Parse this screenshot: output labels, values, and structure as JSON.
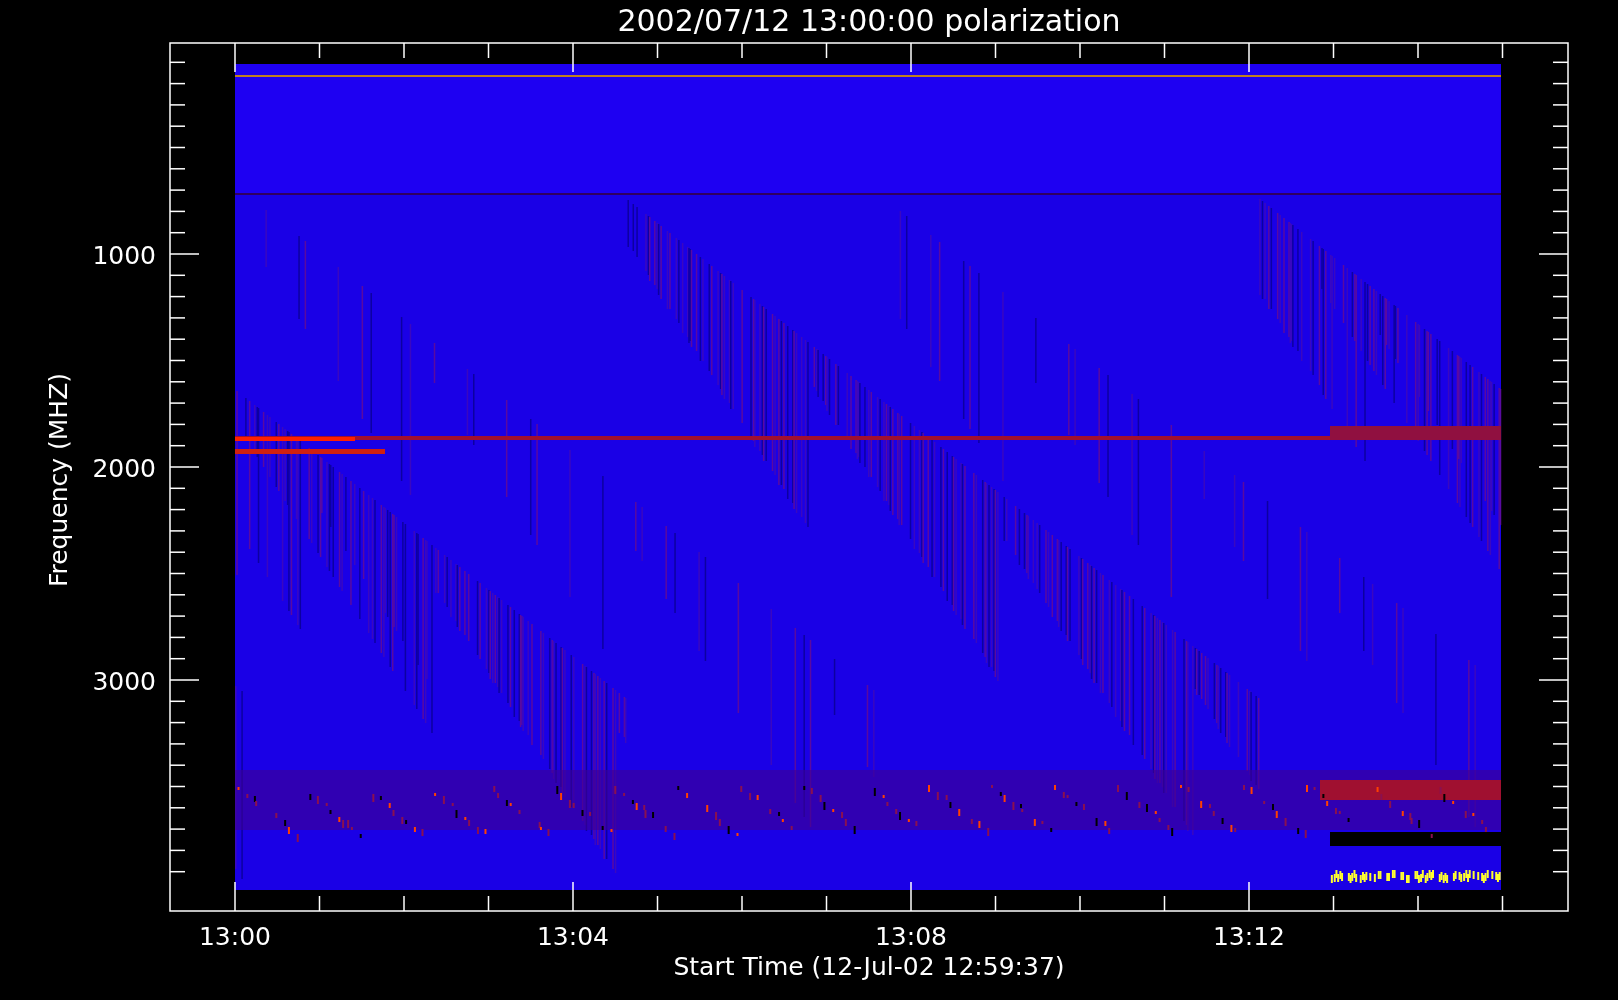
{
  "title": "2002/07/12 13:00:00 polarization",
  "y_axis": {
    "title": "Frequency (MHZ)",
    "ticks": [
      "1000",
      "2000",
      "3000"
    ]
  },
  "x_axis": {
    "title": "Start Time (12-Jul-02 12:59:37)",
    "ticks": [
      "13:00",
      "13:04",
      "13:08",
      "13:12"
    ]
  }
}
